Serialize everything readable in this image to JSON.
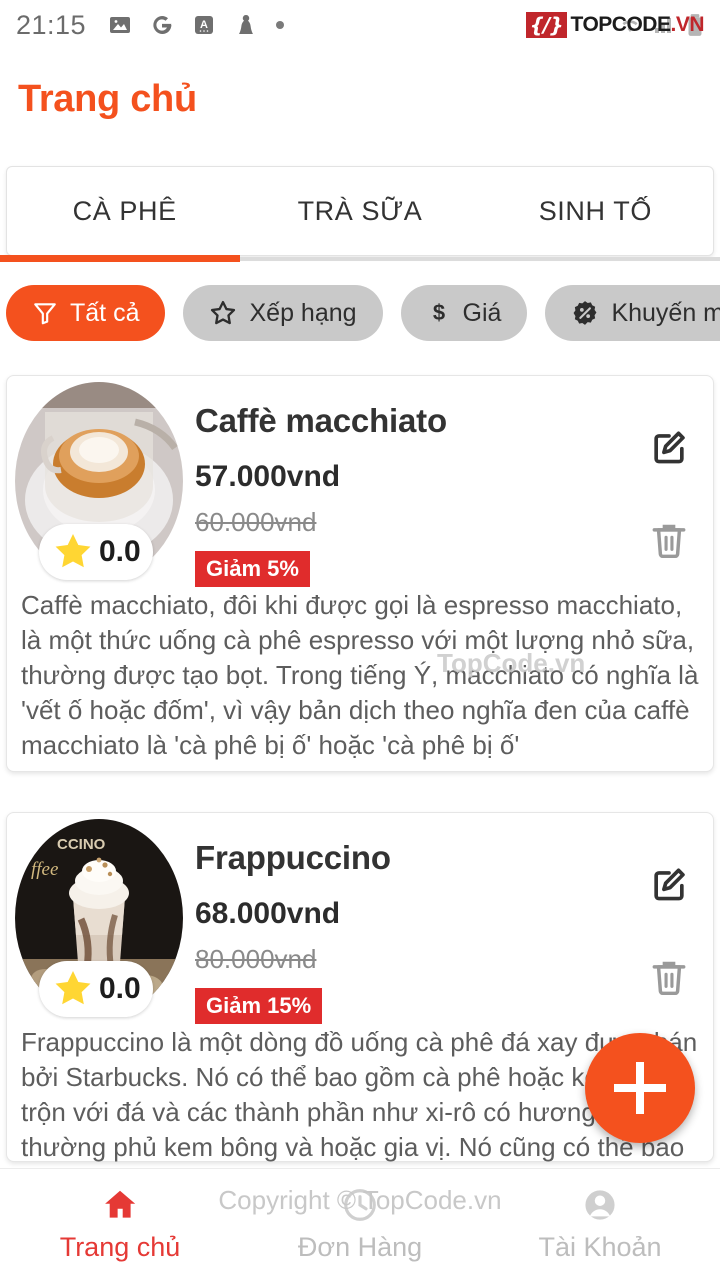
{
  "status_bar": {
    "time": "21:15",
    "left_icons": [
      "photo-icon",
      "google-icon",
      "translate-icon",
      "pawn-icon",
      "dot-icon"
    ],
    "right_icons": [
      "wifi-icon",
      "signal-icon",
      "battery-icon"
    ],
    "watermark_badge": "{/}",
    "watermark_text_1": "TOPCODE",
    "watermark_text_2": ".VN"
  },
  "header": {
    "title": "Trang chủ"
  },
  "tabs": [
    {
      "label": "CÀ PHÊ",
      "active": true
    },
    {
      "label": "TRÀ SỮA",
      "active": false
    },
    {
      "label": "SINH TỐ",
      "active": false
    }
  ],
  "filters": [
    {
      "label": "Tất cả",
      "icon": "filter-icon",
      "active": true
    },
    {
      "label": "Xếp hạng",
      "icon": "star-outline-icon",
      "active": false
    },
    {
      "label": "Giá",
      "icon": "dollar-icon",
      "active": false
    },
    {
      "label": "Khuyến mãi",
      "icon": "discount-badge-icon",
      "active": false
    }
  ],
  "products": [
    {
      "name": "Caffè macchiato",
      "price": "57.000vnd",
      "old_price": "60.000vnd",
      "discount_badge": "Giảm 5%",
      "rating": "0.0",
      "description": "Caffè macchiato, đôi khi được gọi là espresso macchiato, là một thức uống cà phê espresso với một lượng nhỏ sữa, thường được tạo bọt. Trong tiếng Ý, macchiato có nghĩa là 'vết ố hoặc đốm', vì vậy bản dịch theo nghĩa đen của caffè macchiato là 'cà phê bị ố' hoặc 'cà phê bị ố'",
      "image": "espresso-macchiato-cup-photo"
    },
    {
      "name": "Frappuccino",
      "price": "68.000vnd",
      "old_price": "80.000vnd",
      "discount_badge": "Giảm 15%",
      "rating": "0.0",
      "description": "Frappuccino là một dòng đồ uống cà phê đá xay được bán bởi Starbucks. Nó có thể bao gồm cà phê hoặc kem nền, trộn với đá và các thành phần như xi-rô có hương vị và thường phủ kem bông và hoặc gia vị. Nó cũng có thể bao gồm các món tráng miệng pha trộn của Starbucks.",
      "image": "frappuccino-glass-photo"
    }
  ],
  "fab": {
    "icon": "plus-icon",
    "label": "+"
  },
  "bottom_nav": [
    {
      "label": "Trang chủ",
      "icon": "home-icon",
      "active": true
    },
    {
      "label": "Đơn Hàng",
      "icon": "clock-icon",
      "active": false
    },
    {
      "label": "Tài Khoản",
      "icon": "person-icon",
      "active": false
    }
  ],
  "watermarks": {
    "description_overlay": "TopCode.vn",
    "bottom_overlay": "Copyright © TopCode.vn"
  },
  "colors": {
    "accent_orange": "#f4511e",
    "discount_red": "#e02c2c",
    "active_nav_red": "#e53935",
    "chip_grey": "#c9c9c9",
    "star_yellow": "#ffd633"
  }
}
